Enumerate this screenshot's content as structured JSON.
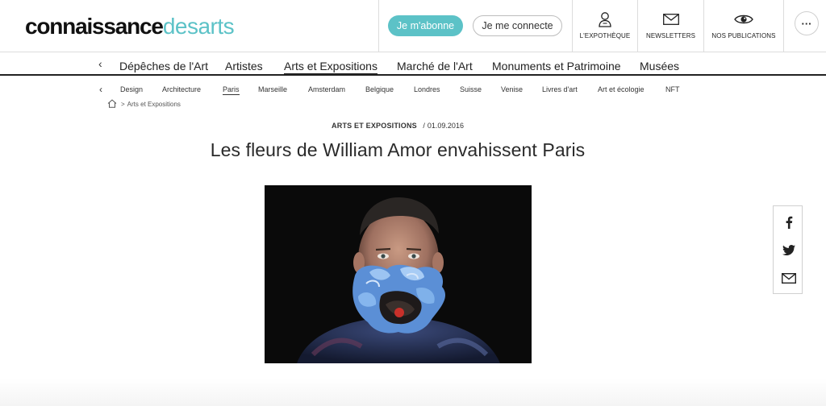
{
  "header": {
    "logo": {
      "part1": "connaissance",
      "part2": "desarts"
    },
    "subscribe_label": "Je m'abonne",
    "login_label": "Je me connecte",
    "items": [
      {
        "label": "L'EXPOTHÈQUE",
        "icon": "person-icon"
      },
      {
        "label": "NEWSLETTERS",
        "icon": "envelope-icon"
      },
      {
        "label": "NOS PUBLICATIONS",
        "icon": "eye-icon"
      }
    ],
    "more_label": "···"
  },
  "main_nav": {
    "items": [
      "Dépêches de l'Art",
      "Artistes",
      "Arts et Expositions",
      "Marché de l'Art",
      "Monuments et Patrimoine",
      "Musées"
    ],
    "active": "Arts et Expositions"
  },
  "sub_nav": {
    "items": [
      "Design",
      "Architecture",
      "Paris",
      "Marseille",
      "Amsterdam",
      "Belgique",
      "Londres",
      "Suisse",
      "Venise",
      "Livres d'art",
      "Art et écologie",
      "NFT"
    ],
    "active": "Paris"
  },
  "breadcrumb": {
    "separator": ">",
    "label": "Arts et Expositions"
  },
  "article": {
    "category": "ARTS ET EXPOSITIONS",
    "date_prefix": "/",
    "date": "01.09.2016",
    "title": "Les fleurs de William Amor envahissent Paris"
  },
  "share": [
    "facebook-icon",
    "twitter-icon",
    "email-icon"
  ],
  "colors": {
    "accent": "#5cc2c7",
    "text": "#222222",
    "border": "#dcdcdc"
  }
}
